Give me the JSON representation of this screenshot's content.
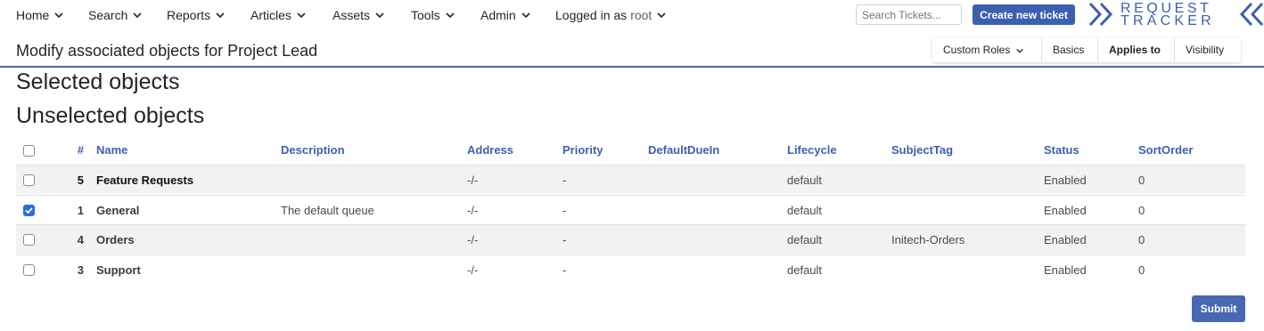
{
  "nav": {
    "items": [
      {
        "label": "Home"
      },
      {
        "label": "Search"
      },
      {
        "label": "Reports"
      },
      {
        "label": "Articles"
      },
      {
        "label": "Assets"
      },
      {
        "label": "Tools"
      },
      {
        "label": "Admin"
      }
    ],
    "logged_in_prefix": "Logged in as",
    "logged_in_user": "root",
    "search_placeholder": "Search Tickets...",
    "create_ticket_label": "Create new ticket",
    "logo_line1": "REQUEST",
    "logo_line2": "TRACKER"
  },
  "header": {
    "title": "Modify associated objects for Project Lead",
    "tabs": [
      {
        "label": "Custom Roles"
      },
      {
        "label": "Basics"
      },
      {
        "label": "Applies to"
      },
      {
        "label": "Visibility"
      }
    ]
  },
  "sections": {
    "selected": "Selected objects",
    "unselected": "Unselected objects"
  },
  "table": {
    "columns": [
      "#",
      "Name",
      "Description",
      "Address",
      "Priority",
      "DefaultDueIn",
      "Lifecycle",
      "SubjectTag",
      "Status",
      "SortOrder"
    ],
    "rows": [
      {
        "checked": false,
        "id": "5",
        "name": "Feature Requests",
        "description": "",
        "address": "-/-",
        "priority": "-",
        "due": "",
        "lifecycle": "default",
        "subject": "",
        "status": "Enabled",
        "sort": "0"
      },
      {
        "checked": true,
        "id": "1",
        "name": "General",
        "description": "The default queue",
        "address": "-/-",
        "priority": "-",
        "due": "",
        "lifecycle": "default",
        "subject": "",
        "status": "Enabled",
        "sort": "0"
      },
      {
        "checked": false,
        "id": "4",
        "name": "Orders",
        "description": "",
        "address": "-/-",
        "priority": "-",
        "due": "",
        "lifecycle": "default",
        "subject": "Initech-Orders",
        "status": "Enabled",
        "sort": "0"
      },
      {
        "checked": false,
        "id": "3",
        "name": "Support",
        "description": "",
        "address": "-/-",
        "priority": "-",
        "due": "",
        "lifecycle": "default",
        "subject": "",
        "status": "Enabled",
        "sort": "0"
      }
    ]
  },
  "submit_label": "Submit",
  "colors": {
    "accent": "#3d5fb0",
    "checkbox_checked": "#2a6fd8",
    "row_shade": "#f2f2f2"
  }
}
